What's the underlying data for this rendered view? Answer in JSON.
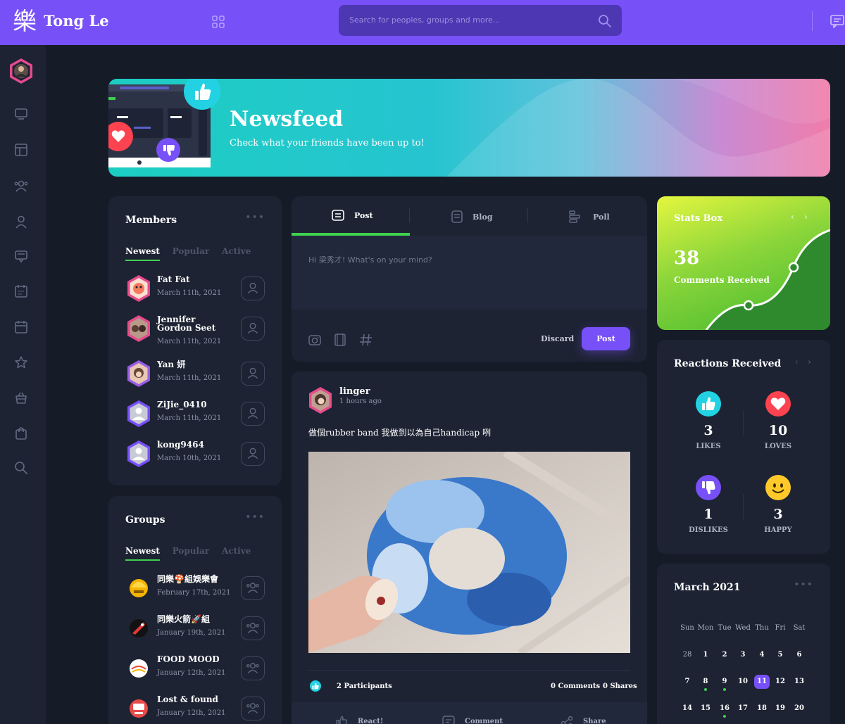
{
  "app": {
    "logo_glyph": "樂",
    "title": "Tong Le"
  },
  "search": {
    "placeholder": "Search for peoples, groups and more..."
  },
  "banner": {
    "title": "Newsfeed",
    "subtitle": "Check what your friends have been up to!"
  },
  "members": {
    "title": "Members",
    "tabs": [
      "Newest",
      "Popular",
      "Active"
    ],
    "items": [
      {
        "name": "Fat Fat",
        "date": "March 11th, 2021"
      },
      {
        "name": "Jennifer Gordon Seet",
        "date": "March 11th, 2021"
      },
      {
        "name": "Yan 妍",
        "date": "March 11th, 2021"
      },
      {
        "name": "ZiJie_0410",
        "date": "March 11th, 2021"
      },
      {
        "name": "kong9464",
        "date": "March 10th, 2021"
      }
    ]
  },
  "groups": {
    "title": "Groups",
    "tabs": [
      "Newest",
      "Popular",
      "Active"
    ],
    "items": [
      {
        "name": "同樂🍄組娛樂會",
        "date": "February 17th, 2021"
      },
      {
        "name": "同樂火箭🚀組",
        "date": "January 19th, 2021"
      },
      {
        "name": "FOOD MOOD",
        "date": "January 12th, 2021"
      },
      {
        "name": "Lost & found",
        "date": "January 12th, 2021"
      }
    ]
  },
  "composer": {
    "tabs": [
      "Post",
      "Blog",
      "Poll"
    ],
    "placeholder": "Hi 梁秀才! What's on your mind?",
    "discard_label": "Discard",
    "post_label": "Post"
  },
  "post": {
    "author": "linger",
    "time": "1 hours ago",
    "text": "做個rubber band 我做到以為自己handicap 咧",
    "participants": "2 Participants",
    "comments": "0 Comments",
    "shares": "0 Shares",
    "actions": [
      "React!",
      "Comment",
      "Share"
    ]
  },
  "stats_box": {
    "title": "Stats Box",
    "value": "38",
    "label": "Comments Received"
  },
  "reactions": {
    "title": "Reactions Received",
    "items": [
      {
        "count": "3",
        "label": "LIKES",
        "color": "#23d2e2"
      },
      {
        "count": "10",
        "label": "LOVES",
        "color": "#fd434f"
      },
      {
        "count": "1",
        "label": "DISLIKES",
        "color": "#7750f8"
      },
      {
        "count": "3",
        "label": "HAPPY",
        "color": "#ffc92a"
      }
    ]
  },
  "calendar": {
    "title": "March 2021",
    "weekdays": [
      "Sun",
      "Mon",
      "Tue",
      "Wed",
      "Thu",
      "Fri",
      "Sat"
    ],
    "weeks": [
      [
        "28",
        "1",
        "2",
        "3",
        "4",
        "5",
        "6"
      ],
      [
        "7",
        "8",
        "9",
        "10",
        "11",
        "12",
        "13"
      ],
      [
        "14",
        "15",
        "16",
        "17",
        "18",
        "19",
        "20"
      ]
    ],
    "today": "11"
  },
  "colors": {
    "accent": "#7750f8",
    "green": "#40d04f",
    "cyan": "#23d2e2",
    "background": "#161b28",
    "card": "#1d2333"
  }
}
